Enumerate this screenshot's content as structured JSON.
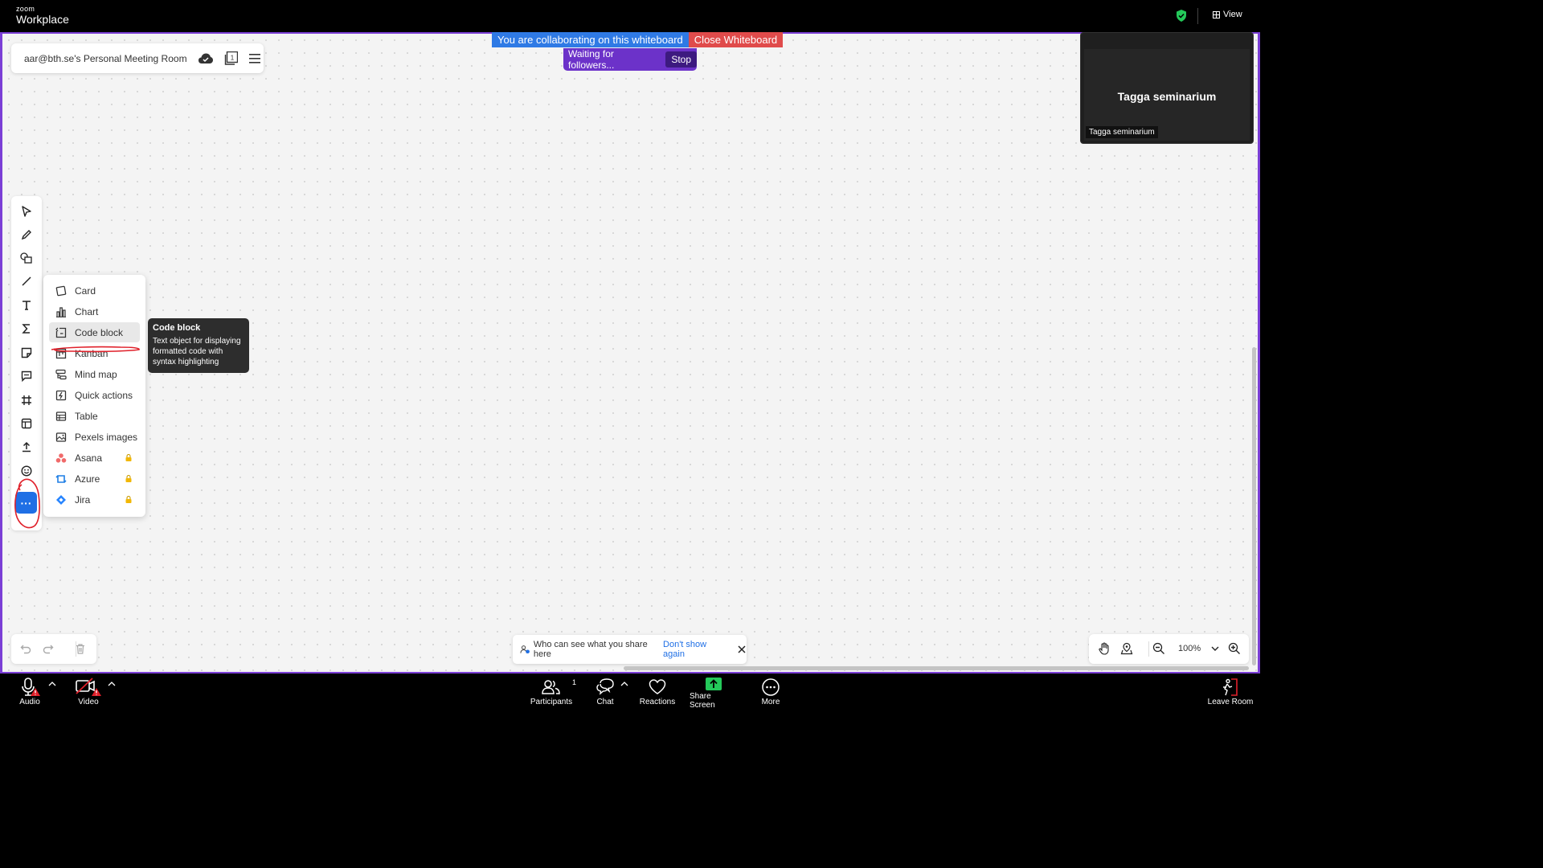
{
  "app": {
    "brand_small": "zoom",
    "brand_big": "Workplace",
    "view_label": "View"
  },
  "room": {
    "title": "aar@bth.se's Personal Meeting Room"
  },
  "banner": {
    "collab_text": "You are collaborating on this whiteboard",
    "close_label": "Close Whiteboard",
    "waiting_text": "Waiting for followers...",
    "stop_label": "Stop"
  },
  "video": {
    "name_big": "Tagga seminarium",
    "name_small": "Tagga seminarium"
  },
  "toolbar": {
    "tools": [
      "select-icon",
      "pen-icon",
      "shapes-icon",
      "line-icon",
      "text-icon",
      "formula-icon",
      "sticky-note-icon",
      "comment-icon",
      "frame-icon",
      "template-icon",
      "upload-icon",
      "emoji-icon"
    ],
    "more_label": "···"
  },
  "more_menu": {
    "items": [
      {
        "label": "Card",
        "icon": "card-icon",
        "locked": false
      },
      {
        "label": "Chart",
        "icon": "chart-icon",
        "locked": false
      },
      {
        "label": "Code block",
        "icon": "code-block-icon",
        "locked": false,
        "active": true
      },
      {
        "label": "Kanban",
        "icon": "kanban-icon",
        "locked": false
      },
      {
        "label": "Mind map",
        "icon": "mind-map-icon",
        "locked": false
      },
      {
        "label": "Quick actions",
        "icon": "quick-actions-icon",
        "locked": false
      },
      {
        "label": "Table",
        "icon": "table-icon",
        "locked": false
      },
      {
        "label": "Pexels images",
        "icon": "image-icon",
        "locked": false
      },
      {
        "label": "Asana",
        "icon": "asana-icon",
        "locked": true
      },
      {
        "label": "Azure",
        "icon": "azure-icon",
        "locked": true
      },
      {
        "label": "Jira",
        "icon": "jira-icon",
        "locked": true
      }
    ]
  },
  "tooltip": {
    "title": "Code block",
    "body": "Text object for displaying formatted code with syntax highlighting"
  },
  "share_notice": {
    "text": "Who can see what you share here",
    "link": "Don't show again"
  },
  "zoom": {
    "value": "100%"
  },
  "bottom_bar": {
    "audio": "Audio",
    "video": "Video",
    "participants": "Participants",
    "participants_count": "1",
    "chat": "Chat",
    "reactions": "Reactions",
    "share_screen": "Share Screen",
    "more": "More",
    "leave": "Leave Room"
  },
  "colors": {
    "accent_purple": "#7b3fd6",
    "collab_blue": "#2f7ae5",
    "close_red": "#e04b4b",
    "share_green": "#24c95a",
    "primary_blue": "#1f6fe5",
    "annotation_red": "#e0202a"
  }
}
